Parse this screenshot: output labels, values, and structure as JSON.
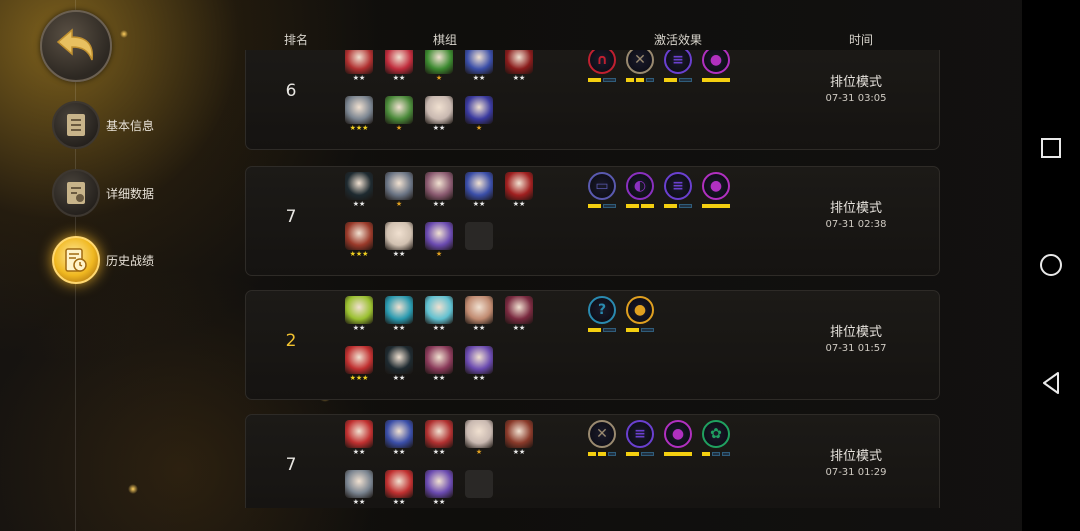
{
  "nav": {
    "items": [
      {
        "label": "基本信息",
        "icon": "scroll-icon"
      },
      {
        "label": "详细数据",
        "icon": "data-sheet-icon"
      },
      {
        "label": "历史战绩",
        "icon": "history-clock-icon"
      }
    ],
    "active_index": 2
  },
  "table": {
    "headers": {
      "rank": "排名",
      "lineup": "棋组",
      "effects": "激活效果",
      "time": "时间"
    },
    "rows": [
      {
        "rank": "6",
        "mode": "排位模式",
        "time": "07-31 03:05",
        "pieces": [
          {
            "color": "#b03030",
            "stars": "★★"
          },
          {
            "color": "#c02c3c",
            "stars": "★★"
          },
          {
            "color": "#3c8a30",
            "stars": "★"
          },
          {
            "color": "#3a4ea8",
            "stars": "★★"
          },
          {
            "color": "#8a1c1c",
            "stars": "★★"
          },
          {
            "color": "#7a8490",
            "stars": "★★★"
          },
          {
            "color": "#4a8a3a",
            "stars": "★"
          },
          {
            "color": "#c8b8b0",
            "stars": "★★"
          },
          {
            "color": "#3a3aa0",
            "stars": "★"
          }
        ],
        "effects": [
          {
            "color": "#c02030",
            "glyph": "∩",
            "filled": 1,
            "total": 2
          },
          {
            "color": "#9a8a70",
            "glyph": "✕",
            "filled": 2,
            "total": 3
          },
          {
            "color": "#6a40d0",
            "glyph": "≡",
            "filled": 1,
            "total": 2
          },
          {
            "color": "#b030c0",
            "glyph": "●",
            "filled": 1,
            "total": 1
          }
        ]
      },
      {
        "rank": "7",
        "mode": "排位模式",
        "time": "07-31 02:38",
        "pieces": [
          {
            "color": "#1e2a30",
            "stars": "★★"
          },
          {
            "color": "#6a7484",
            "stars": "★"
          },
          {
            "color": "#8a5a70",
            "stars": "★★"
          },
          {
            "color": "#3a4ea8",
            "stars": "★★"
          },
          {
            "color": "#a02020",
            "stars": "★★"
          },
          {
            "color": "#9a3a2a",
            "stars": "★★★"
          },
          {
            "color": "#d0c0b0",
            "stars": "★★"
          },
          {
            "color": "#6a4ab0",
            "stars": "★"
          },
          {
            "color": "",
            "stars": ""
          }
        ],
        "effects": [
          {
            "color": "#5a5ab0",
            "glyph": "▭",
            "filled": 1,
            "total": 2
          },
          {
            "color": "#8a30c0",
            "glyph": "◐",
            "filled": 2,
            "total": 2
          },
          {
            "color": "#6a40d0",
            "glyph": "≡",
            "filled": 1,
            "total": 2
          },
          {
            "color": "#b030c0",
            "glyph": "●",
            "filled": 1,
            "total": 1
          }
        ]
      },
      {
        "rank": "2",
        "mode": "排位模式",
        "time": "07-31 01:57",
        "pieces": [
          {
            "color": "#9ac030",
            "stars": "★★"
          },
          {
            "color": "#2a9ab0",
            "stars": "★★"
          },
          {
            "color": "#60c0d0",
            "stars": "★★"
          },
          {
            "color": "#c08a70",
            "stars": "★★"
          },
          {
            "color": "#7a2a40",
            "stars": "★★"
          },
          {
            "color": "#c03030",
            "stars": "★★★"
          },
          {
            "color": "#1e2a30",
            "stars": "★★"
          },
          {
            "color": "#8a3a5a",
            "stars": "★★"
          },
          {
            "color": "#6a4ab0",
            "stars": "★★"
          }
        ],
        "effects": [
          {
            "color": "#2a8ab0",
            "glyph": "?",
            "filled": 1,
            "total": 2
          },
          {
            "color": "#e0a020",
            "glyph": "●",
            "filled": 1,
            "total": 2
          }
        ]
      },
      {
        "rank": "7",
        "mode": "排位模式",
        "time": "07-31 01:29",
        "pieces": [
          {
            "color": "#c03030",
            "stars": "★★"
          },
          {
            "color": "#3a4ea8",
            "stars": "★★"
          },
          {
            "color": "#b03030",
            "stars": "★★"
          },
          {
            "color": "#c8b8b0",
            "stars": "★"
          },
          {
            "color": "#8a3a2a",
            "stars": "★★"
          },
          {
            "color": "#7a8490",
            "stars": "★★"
          },
          {
            "color": "#c03030",
            "stars": "★★"
          },
          {
            "color": "#6a4ab0",
            "stars": "★★"
          },
          {
            "color": "",
            "stars": ""
          }
        ],
        "effects": [
          {
            "color": "#9a8a70",
            "glyph": "✕",
            "filled": 2,
            "total": 3
          },
          {
            "color": "#6a40d0",
            "glyph": "≡",
            "filled": 1,
            "total": 2
          },
          {
            "color": "#b030c0",
            "glyph": "●",
            "filled": 1,
            "total": 1
          },
          {
            "color": "#20a060",
            "glyph": "✿",
            "filled": 1,
            "total": 3
          }
        ]
      }
    ]
  },
  "system_nav": [
    "recent-apps-icon",
    "home-icon",
    "back-triangle-icon"
  ]
}
